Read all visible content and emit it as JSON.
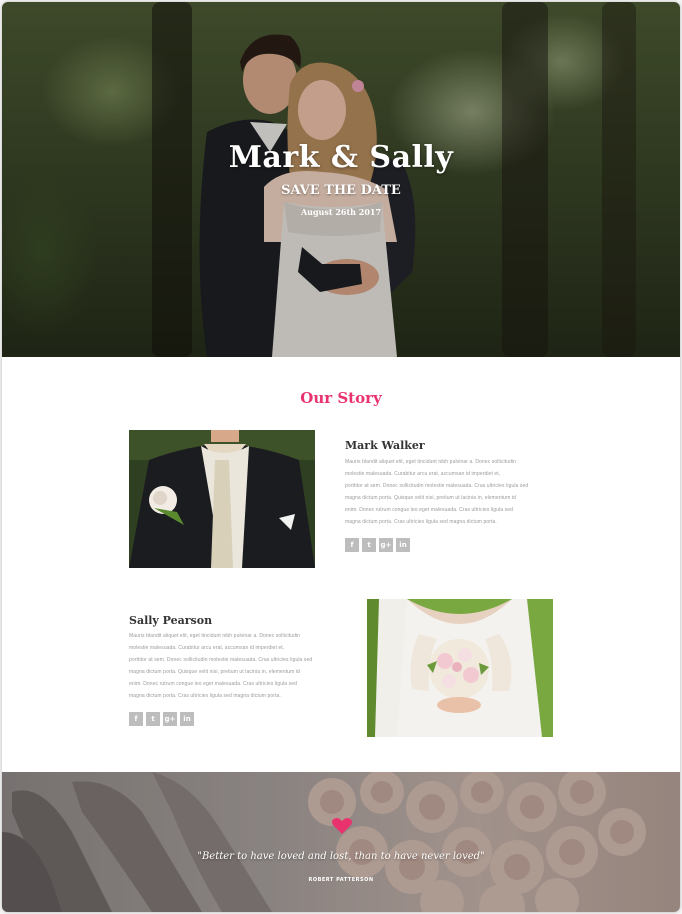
{
  "hero": {
    "title": "Mark & Sally",
    "subtitle": "SAVE THE DATE",
    "date": "August 26th 2017"
  },
  "story": {
    "title": "Our Story",
    "groom": {
      "name": "Mark Walker",
      "bio_lines": [
        "Mauris blandit aliquet elit, eget tincidunt nibh pulvinar a. Donec sollicitudin",
        "molestie malesuada. Curabitur arcu erat, accumsan id imperdiet et,",
        "porttitor at sem. Donec sollicitudin molestie malesuada. Cras ultricies ligula sed",
        "magna dictum porta. Quisque velit nisi, pretium ut lacinia in, elementum id",
        "enim. Donec rutrum congue leo eget malesuada. Cras ultricies ligula sed",
        "magna dictum porta. Cras ultricies ligula sed magna dictum porta."
      ],
      "socials": [
        "f",
        "t",
        "g+",
        "in"
      ]
    },
    "bride": {
      "name": "Sally Pearson",
      "bio_lines": [
        "Mauris blandit aliquet elit, eget tincidunt nibh pulvinar a. Donec sollicitudin",
        "molestie malesuada. Curabitur arcu erat, accumsan id imperdiet et,",
        "porttitor at sem. Donec sollicitudin molestie malesuada. Cras ultricies ligula sed",
        "magna dictum porta. Quisque velit nisi, pretium ut lacinia in, elementum id",
        "enim. Donec rutrum congue leo eget malesuada. Cras ultricies ligula sed",
        "magna dictum porta. Cras ultricies ligula sed magna dictum porta."
      ],
      "socials": [
        "f",
        "t",
        "g+",
        "in"
      ]
    }
  },
  "quote": {
    "text": "\"Better to have loved and lost, than to have never loved\"",
    "author": "ROBERT PATTERSON"
  },
  "colors": {
    "accent": "#e8336e",
    "social_bg": "#bdbdbd"
  }
}
